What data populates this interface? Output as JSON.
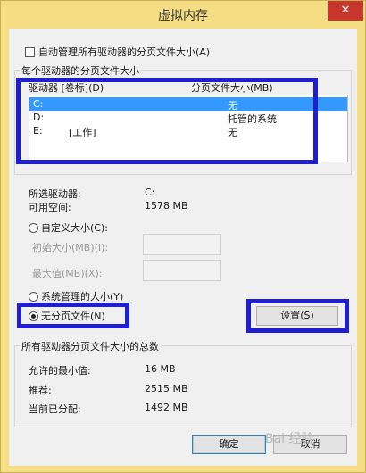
{
  "window": {
    "title": "虚拟内存",
    "close_glyph": "✕"
  },
  "auto_manage": {
    "label": "自动管理所有驱动器的分页文件大小(A)",
    "checked": false
  },
  "per_drive": {
    "group_title": "每个驱动器的分页文件大小",
    "col_drive": "驱动器 [卷标](D)",
    "col_size": "分页文件大小(MB)",
    "rows": [
      {
        "drive": "C:",
        "label": "",
        "size": "无",
        "selected": true
      },
      {
        "drive": "D:",
        "label": "",
        "size": "托管的系统",
        "selected": false
      },
      {
        "drive": "E:",
        "label": "[工作]",
        "size": "无",
        "selected": false
      }
    ]
  },
  "selected_info": {
    "drive_label": "所选驱动器:",
    "drive_value": "C:",
    "space_label": "可用空间:",
    "space_value": "1578 MB"
  },
  "custom": {
    "label": "自定义大小(C):",
    "initial_label": "初始大小(MB)(I):",
    "max_label": "最大值(MB)(X):"
  },
  "system_managed": {
    "label": "系统管理的大小(Y)"
  },
  "no_paging": {
    "label": "无分页文件(N)"
  },
  "set_button": {
    "label": "设置(S)"
  },
  "totals": {
    "group_title": "所有驱动器分页文件大小的总数",
    "min_label": "允许的最小值:",
    "min_value": "16 MB",
    "recommended_label": "推荐:",
    "recommended_value": "2515 MB",
    "current_label": "当前已分配:",
    "current_value": "1492 MB"
  },
  "buttons": {
    "ok": "确定",
    "cancel": "取消"
  },
  "selected_option": "no_paging",
  "colors": {
    "title_bar": "#f4dd82",
    "highlight": "#1f1fd0",
    "selection": "#3399ff",
    "close_button": "#c8372d"
  },
  "watermark": "Bai 经验"
}
